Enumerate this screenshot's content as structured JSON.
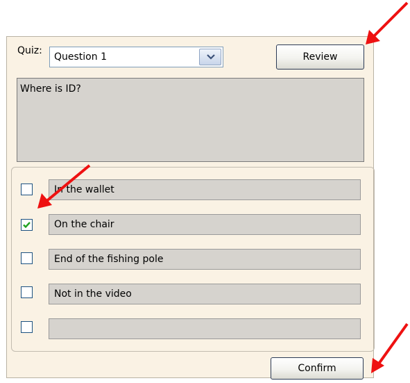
{
  "quiz": {
    "label": "Quiz:",
    "selected_question": "Question 1",
    "review_label": "Review",
    "confirm_label": "Confirm"
  },
  "question": {
    "text": "Where is ID?"
  },
  "options": [
    {
      "text": "In the wallet",
      "checked": false
    },
    {
      "text": "On the chair",
      "checked": true
    },
    {
      "text": "End of the fishing pole",
      "checked": false
    },
    {
      "text": "Not in the video",
      "checked": false
    },
    {
      "text": "",
      "checked": false
    }
  ],
  "colors": {
    "panel_bg": "#faf2e4",
    "field_bg": "#d6d3ce",
    "annotation_arrow": "#ee1111",
    "check_mark": "#21a121"
  }
}
